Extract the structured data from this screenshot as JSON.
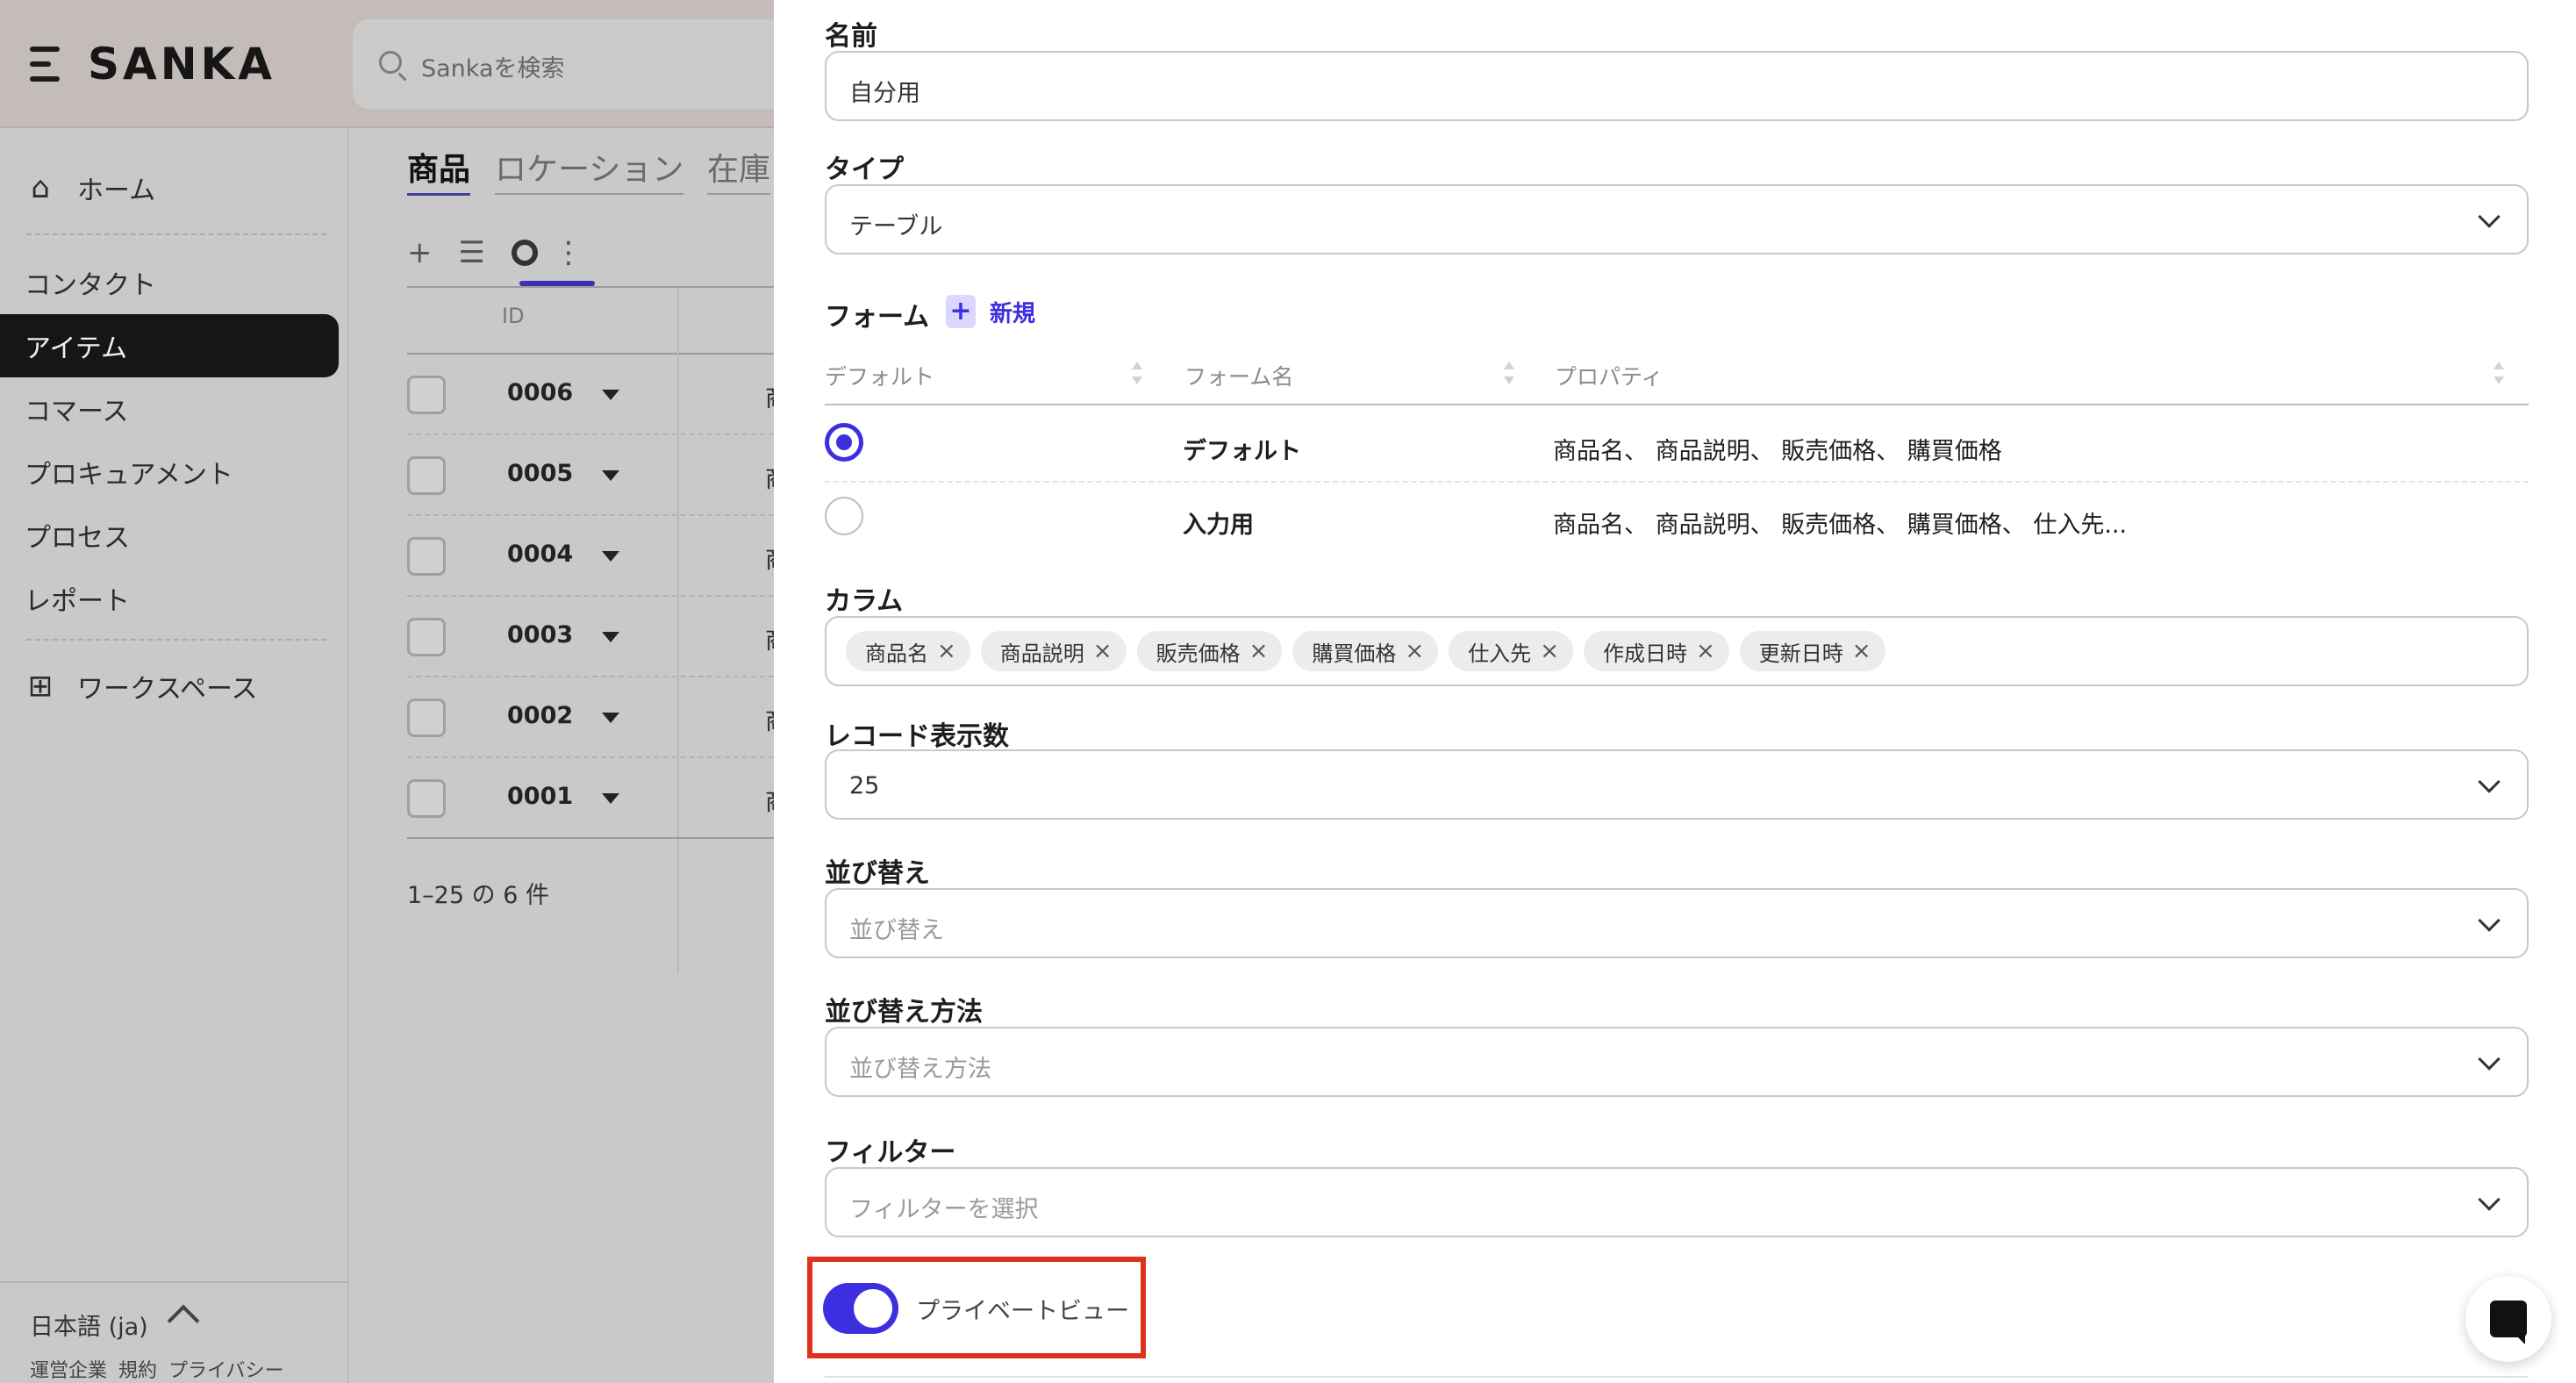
{
  "app": {
    "brand": "SANKA",
    "search_placeholder": "Sankaを検索"
  },
  "sidebar": {
    "home": "ホーム",
    "items": [
      {
        "label": "コンタクト",
        "active": false
      },
      {
        "label": "アイテム",
        "active": true
      },
      {
        "label": "コマース",
        "active": false
      },
      {
        "label": "プロキュアメント",
        "active": false
      },
      {
        "label": "プロセス",
        "active": false
      },
      {
        "label": "レポート",
        "active": false
      }
    ],
    "workspace": "ワークスペース",
    "language": "日本語 (ja)",
    "footer_links": "運営企業 規約 プライバシー"
  },
  "content": {
    "tabs": [
      "商品",
      "ロケーション",
      "在庫"
    ],
    "toolbar": {
      "add": "+",
      "list": "☰",
      "more": "⋮"
    },
    "id_header": "ID",
    "rows": [
      {
        "id": "0006",
        "col2": "商"
      },
      {
        "id": "0005",
        "col2": "商"
      },
      {
        "id": "0004",
        "col2": "商"
      },
      {
        "id": "0003",
        "col2": "商"
      },
      {
        "id": "0002",
        "col2": "商"
      },
      {
        "id": "0001",
        "col2": "商"
      }
    ],
    "pager": "1–25 の 6 件"
  },
  "drawer": {
    "name_label": "名前",
    "name_value": "自分用",
    "type_label": "タイプ",
    "type_value": "テーブル",
    "form_label": "フォーム",
    "new_label": "新規",
    "form_table": {
      "headers": [
        "デフォルト",
        "フォーム名",
        "プロパティ"
      ],
      "rows": [
        {
          "default": true,
          "name": "デフォルト",
          "props": "商品名、 商品説明、 販売価格、 購買価格"
        },
        {
          "default": false,
          "name": "入力用",
          "props": "商品名、 商品説明、 販売価格、 購買価格、 仕入先..."
        }
      ]
    },
    "columns_label": "カラム",
    "columns": [
      "商品名",
      "商品説明",
      "販売価格",
      "購買価格",
      "仕入先",
      "作成日時",
      "更新日時"
    ],
    "records_label": "レコード表示数",
    "records_value": "25",
    "sort_label": "並び替え",
    "sort_placeholder": "並び替え",
    "sort_method_label": "並び替え方法",
    "sort_method_placeholder": "並び替え方法",
    "filter_label": "フィルター",
    "filter_placeholder": "フィルターを選択",
    "private_view_label": "プライベートビュー",
    "private_view_on": true
  },
  "colors": {
    "accent": "#3c2fe0",
    "highlight": "#e0311d",
    "sidebar_active": "#161616"
  }
}
